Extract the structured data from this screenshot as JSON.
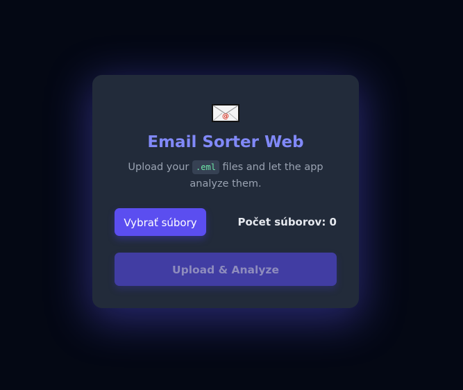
{
  "app": {
    "title": "Email Sorter Web",
    "logo_icon": "envelope-icon"
  },
  "intro": {
    "before": "Upload your",
    "code": ".eml",
    "after": "files and let the app analyze them."
  },
  "file_picker": {
    "button_label": "Vybrať súbory",
    "count_label": "Počet súborov: 0"
  },
  "actions": {
    "upload_label": "Upload & Analyze"
  },
  "colors": {
    "background": "#040814",
    "card": "#222b3a",
    "accent": "#8189f8",
    "primary_button": "#5b4ef0",
    "disabled_button": "#413da3",
    "code_text": "#6ee7a8"
  }
}
